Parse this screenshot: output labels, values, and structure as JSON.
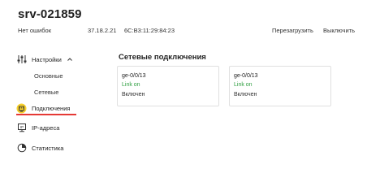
{
  "header": {
    "hostname": "srv-021859",
    "status": "Нет ошибок",
    "ip": "37.18.2.21",
    "mac": "6C:B3:11:29:84:23",
    "restart_label": "Перезагрузить",
    "shutdown_label": "Выключить"
  },
  "sidebar": {
    "settings_label": "Настройки",
    "sub_items": [
      "Основные",
      "Сетевые"
    ],
    "connections_label": "Подключения",
    "ip_label": "IP-адреса",
    "stats_label": "Статистика",
    "icons": {
      "settings": "sliders-icon",
      "connections": "ethernet-port-icon",
      "ip": "ip-address-icon",
      "stats": "pie-chart-icon"
    },
    "active_item": "Подключения"
  },
  "main": {
    "title": "Сетевые подключения",
    "cards": [
      {
        "name": "ge-0/0/13",
        "link": "Link on",
        "state": "Включен"
      },
      {
        "name": "ge-0/0/13",
        "link": "Link on",
        "state": "Включен"
      }
    ]
  },
  "colors": {
    "accent_red": "#e53935",
    "link_green": "#2e9e3f",
    "highlight_yellow": "#f7d02c"
  }
}
